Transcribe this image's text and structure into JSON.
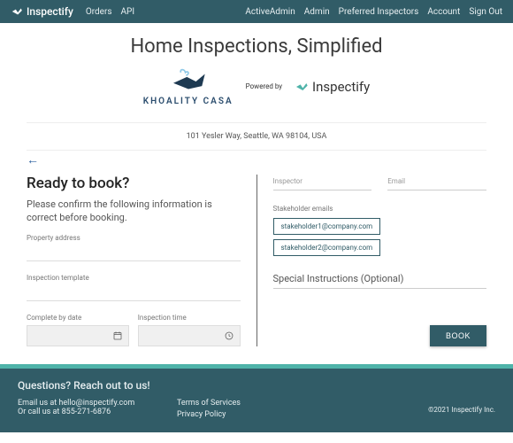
{
  "topbar": {
    "brand": "Inspectify",
    "nav_left": [
      "Orders",
      "API"
    ],
    "nav_right": [
      "ActiveAdmin",
      "Admin",
      "Preferred Inspectors",
      "Account",
      "Sign Out"
    ]
  },
  "hero": {
    "title": "Home Inspections, Simplified",
    "khoality": "KHOALITY CASA",
    "powered_by": "Powered by",
    "inspectify": "Inspectify"
  },
  "address": "101 Yesler Way, Seattle, WA 98104, USA",
  "booking": {
    "heading": "Ready to book?",
    "subheading": "Please confirm the following information is correct before booking.",
    "property_label": "Property address",
    "template_label": "Inspection template",
    "date_label": "Complete by date",
    "time_label": "Inspection time"
  },
  "details": {
    "inspector_label": "Inspector",
    "email_label": "Email",
    "stakeholder_label": "Stakeholder emails",
    "stakeholders": [
      "stakeholder1@company.com",
      "stakeholder2@company.com"
    ],
    "special_label": "Special Instructions (Optional)",
    "book_button": "BOOK"
  },
  "footer": {
    "heading": "Questions? Reach out to us!",
    "email_line": "Email us at hello@inspectify.com",
    "phone_line": "Or call us at 855-271-6876",
    "links": [
      "Terms of Services",
      "Privacy Policy"
    ],
    "copyright": "©2021 Inspectify Inc."
  }
}
